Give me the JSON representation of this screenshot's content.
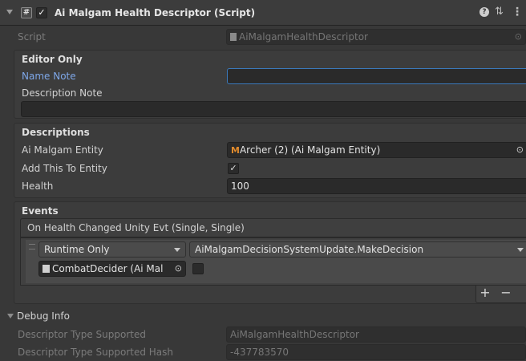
{
  "header": {
    "title": "Ai Malgam Health Descriptor (Script)",
    "enabled": true
  },
  "script_row": {
    "label": "Script",
    "value": "AiMalgamHealthDescriptor"
  },
  "editor_only": {
    "title": "Editor Only",
    "name_note_label": "Name Note",
    "name_note_value": "",
    "description_note_label": "Description Note",
    "description_note_value": ""
  },
  "descriptions": {
    "title": "Descriptions",
    "entity_label": "Ai Malgam Entity",
    "entity_value": "Archer (2) (Ai Malgam Entity)",
    "add_label": "Add This To Entity",
    "add_checked": true,
    "health_label": "Health",
    "health_value": "100"
  },
  "events": {
    "title": "Events",
    "event_name": "On Health Changed Unity Evt (Single, Single)",
    "runtime_option": "Runtime Only",
    "function_value": "AiMalgamDecisionSystemUpdate.MakeDecision",
    "target_object": "CombatDecider (Ai Mal",
    "arg_checked": false,
    "add_symbol": "+",
    "remove_symbol": "−"
  },
  "debug": {
    "title": "Debug Info",
    "type_label": "Descriptor Type Supported",
    "type_value": "AiMalgamHealthDescriptor",
    "hash_label": "Descriptor Type Supported Hash",
    "hash_value": "-437783570"
  },
  "colors": {
    "background": "#383838",
    "field": "#2a2a2a",
    "accent_blue": "#7ea7e8",
    "focus_border": "#3a79bb",
    "entity_icon": "#e08a2c"
  }
}
